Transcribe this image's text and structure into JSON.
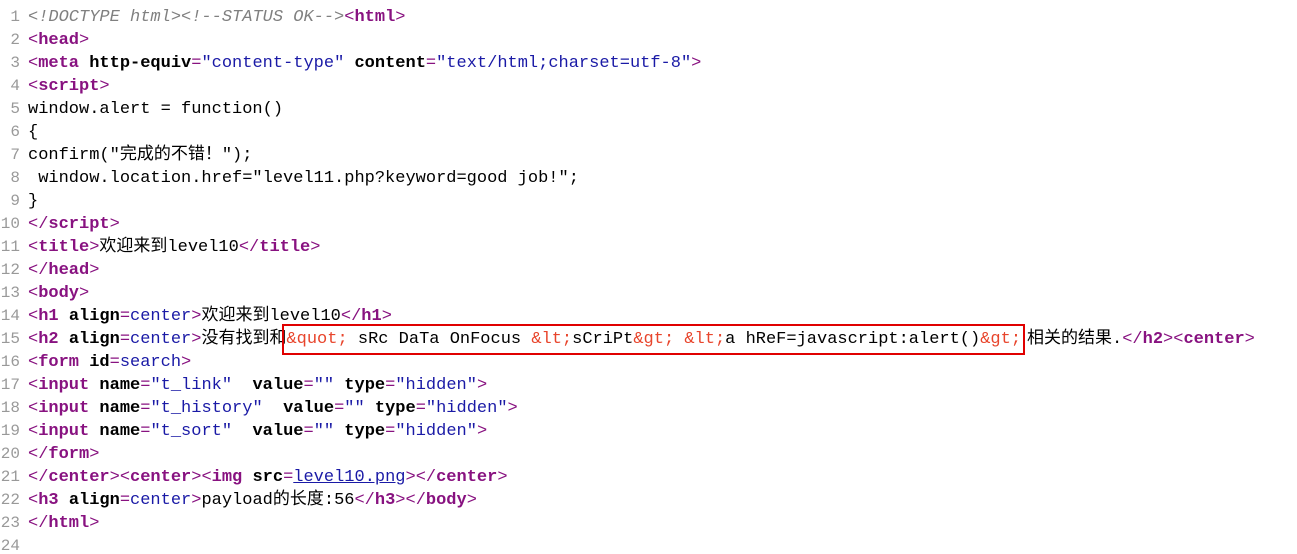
{
  "line_numbers": [
    "1",
    "2",
    "3",
    "4",
    "5",
    "6",
    "7",
    "8",
    "9",
    "10",
    "11",
    "12",
    "13",
    "14",
    "15",
    "16",
    "17",
    "18",
    "19",
    "20",
    "21",
    "22",
    "23",
    "24"
  ],
  "l1": {
    "doctype": "<!DOCTYPE html>",
    "comment": "<!--STATUS OK-->",
    "tag": "html"
  },
  "l2": {
    "tag": "head"
  },
  "l3": {
    "tag": "meta",
    "attr1": "http-equiv",
    "val1": "\"content-type\"",
    "attr2": "content",
    "val2": "\"text/html;charset=utf-8\""
  },
  "l4": {
    "tag": "script"
  },
  "l5": {
    "text": "window.alert = function()"
  },
  "l6": {
    "text": "{"
  },
  "l7": {
    "text": "confirm(\"完成的不错！\");"
  },
  "l8": {
    "text": " window.location.href=\"level11.php?keyword=good job!\";"
  },
  "l9": {
    "text": "}"
  },
  "l10": {
    "tag": "script"
  },
  "l11": {
    "tag": "title",
    "text": "欢迎来到level10"
  },
  "l12": {
    "tag": "head"
  },
  "l13": {
    "tag": "body"
  },
  "l14": {
    "tag": "h1",
    "attr": "align",
    "val": "center",
    "text": "欢迎来到level10"
  },
  "l15": {
    "tag": "h2",
    "attr": "align",
    "val": "center",
    "prefix_text": "没有找到和",
    "e_quot": "&quot;",
    "seg1": " sRc DaTa OnFocus ",
    "e_lt1": "&lt;",
    "seg2": "sCriPt",
    "e_gt1": "&gt;",
    "seg3": " ",
    "e_lt2": "&lt;",
    "seg4": "a hReF=javascript:alert()",
    "e_gt2": "&gt;",
    "suffix_text": "相关的结果.",
    "tag_center": "center"
  },
  "l16": {
    "tag": "form",
    "attr": "id",
    "val": "search"
  },
  "l17": {
    "tag": "input",
    "a1": "name",
    "v1": "\"t_link\"",
    "a2": "value",
    "v2": "\"\"",
    "a3": "type",
    "v3": "\"hidden\""
  },
  "l18": {
    "tag": "input",
    "a1": "name",
    "v1": "\"t_history\"",
    "a2": "value",
    "v2": "\"\"",
    "a3": "type",
    "v3": "\"hidden\""
  },
  "l19": {
    "tag": "input",
    "a1": "name",
    "v1": "\"t_sort\"",
    "a2": "value",
    "v2": "\"\"",
    "a3": "type",
    "v3": "\"hidden\""
  },
  "l20": {
    "tag": "form"
  },
  "l21": {
    "tag_center": "center",
    "tag_img": "img",
    "attr": "src",
    "link": "level10.png"
  },
  "l22": {
    "tag": "h3",
    "attr": "align",
    "val": "center",
    "text": "payload的长度:56",
    "tag_body": "body"
  },
  "l23": {
    "tag": "html"
  },
  "colors": {
    "tag": "#881280",
    "value": "#1a1aa6",
    "entity": "#e8452c",
    "highlight_box": "#e00000"
  }
}
